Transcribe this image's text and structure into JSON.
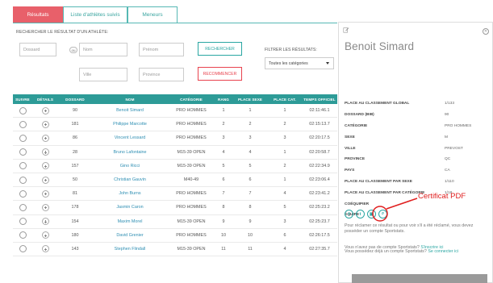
{
  "tabs": [
    {
      "label": "Résultats",
      "active": true
    },
    {
      "label": "Liste d'athlètes suivis",
      "active": false
    },
    {
      "label": "Meneurs",
      "active": false
    }
  ],
  "search": {
    "title": "RECHERCHER LE RÉSULTAT D'UN ATHLÈTE:",
    "bib_placeholder": "Dossard",
    "or_label": "ou",
    "nom_placeholder": "Nom",
    "prenom_placeholder": "Prénom",
    "ville_placeholder": "Ville",
    "province_placeholder": "Province",
    "search_button": "RECHERCHER",
    "reset_button": "RECOMMENCER"
  },
  "filter": {
    "title": "FILTRER LES RÉSULTATS:",
    "selected": "Toutes les catégories"
  },
  "table": {
    "headers": [
      "SUIVRE",
      "DÉTAILS",
      "DOSSARD",
      "NOM",
      "CATÉGORIE",
      "RANG",
      "PLACE SEXE",
      "PLACE CAT.",
      "TEMPS OFFICIEL"
    ],
    "rows": [
      [
        "90",
        "Benoit Simard",
        "PRO HOMMES",
        "1",
        "1",
        "1",
        "02:11:46.1"
      ],
      [
        "181",
        "Philippe Marcotte",
        "PRO HOMMES",
        "2",
        "2",
        "2",
        "02:15:13.7"
      ],
      [
        "86",
        "Vincent Lessard",
        "PRO HOMMES",
        "3",
        "3",
        "3",
        "02:20:17.5"
      ],
      [
        "28",
        "Bruno Lafontaine",
        "M15-39 OPEN",
        "4",
        "4",
        "1",
        "02:20:58.7"
      ],
      [
        "157",
        "Gino Ricci",
        "M15-39 OPEN",
        "5",
        "5",
        "2",
        "02:22:34.9"
      ],
      [
        "50",
        "Christian Gauvin",
        "M40-49",
        "6",
        "6",
        "1",
        "02:23:06.4"
      ],
      [
        "81",
        "John Burns",
        "PRO HOMMES",
        "7",
        "7",
        "4",
        "02:23:41.2"
      ],
      [
        "178",
        "Jasmin Caron",
        "PRO HOMMES",
        "8",
        "8",
        "5",
        "02:25:23.2"
      ],
      [
        "154",
        "Maxim Morel",
        "M15-39 OPEN",
        "9",
        "9",
        "3",
        "02:25:23.7"
      ],
      [
        "180",
        "David Grenier",
        "PRO HOMMES",
        "10",
        "10",
        "6",
        "02:26:17.5"
      ],
      [
        "143",
        "Stephen Flindall",
        "M15-39 OPEN",
        "11",
        "11",
        "4",
        "02:27:35.7"
      ]
    ]
  },
  "detail": {
    "name": "Benoit Simard",
    "fields": [
      {
        "label": "PLACE AU CLASSEMENT GLOBAL",
        "value": "1/133"
      },
      {
        "label": "DOSSARD (BIB)",
        "value": "90"
      },
      {
        "label": "CATÉGORIE",
        "value": "PRO HOMMES"
      },
      {
        "label": "SEXE",
        "value": "M"
      },
      {
        "label": "VILLE",
        "value": "PREVOST"
      },
      {
        "label": "PROVINCE",
        "value": "QC"
      },
      {
        "label": "PAYS",
        "value": "CA"
      },
      {
        "label": "PLACE AU CLASSEMENT PAR SEXE",
        "value": "1/110"
      },
      {
        "label": "PLACE AU CLASSEMENT PAR CATÉGORIE",
        "value": "1/18"
      },
      {
        "label": "COÉQUIPIER",
        "value": ""
      },
      {
        "label": "ÉQUIPE",
        "value": ""
      }
    ],
    "share_icons": [
      "facebook-icon",
      "twitter-icon",
      "pdf-icon",
      "search-icon"
    ],
    "claim_text": "Pour réclamer ce résultat ou pour voir s'il a été réclamé, vous devez posséder un compte Sportstats.",
    "no_account_text": "Vous n'avez pas de compte Sportstats?",
    "signup_link": "S'inscrire ici",
    "has_account_text": "Vous possédez déjà un compte Sportstats?",
    "login_link": "Se connecter ici"
  },
  "annotation": {
    "label": "Certificat PDF",
    "color": "#e02020"
  }
}
